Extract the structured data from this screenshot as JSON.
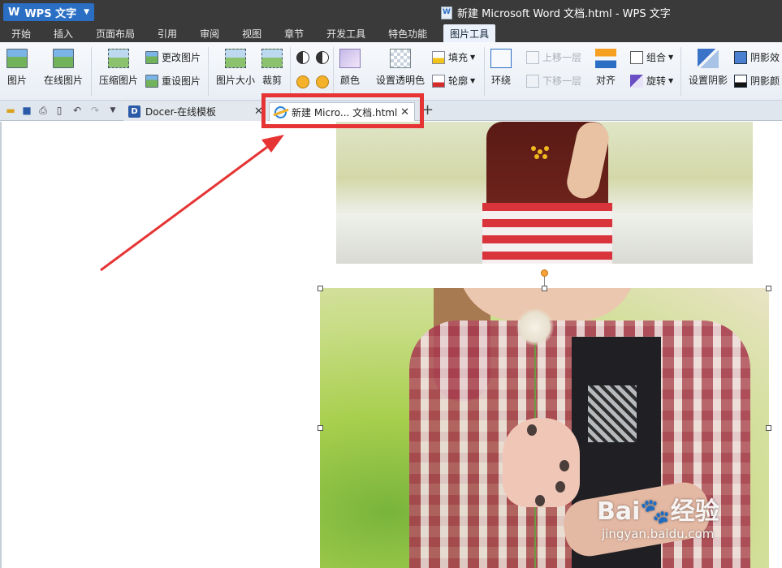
{
  "app": {
    "menu_button": "WPS 文字",
    "window_title": "新建 Microsoft Word 文档.html - WPS 文字"
  },
  "menu": {
    "items": [
      "开始",
      "插入",
      "页面布局",
      "引用",
      "审阅",
      "视图",
      "章节",
      "开发工具",
      "特色功能",
      "图片工具"
    ],
    "active": "图片工具"
  },
  "ribbon": {
    "picture": "图片",
    "online_picture": "在线图片",
    "compress": "压缩图片",
    "change_picture": "更改图片",
    "reset_picture": "重设图片",
    "picture_size": "图片大小",
    "crop": "裁剪",
    "color": "颜色",
    "set_transparent": "设置透明色",
    "fill": "填充",
    "outline": "轮廓",
    "wrap": "环绕",
    "bring_forward": "上移一层",
    "send_backward": "下移一层",
    "align": "对齐",
    "group": "组合",
    "rotate": "旋转",
    "set_shadow": "设置阴影",
    "shadow_effect": "阴影效",
    "shadow_color": "阴影颜"
  },
  "tabs": {
    "docer": "Docer-在线模板",
    "document": "新建 Micro... 文档.html"
  },
  "watermark": {
    "brand": "Bai🐾经验",
    "url": "jingyan.baidu.com"
  },
  "colors": {
    "titlebar": "#3a3a3a",
    "app_button": "#2b6fc4",
    "highlight": "#e63434"
  }
}
